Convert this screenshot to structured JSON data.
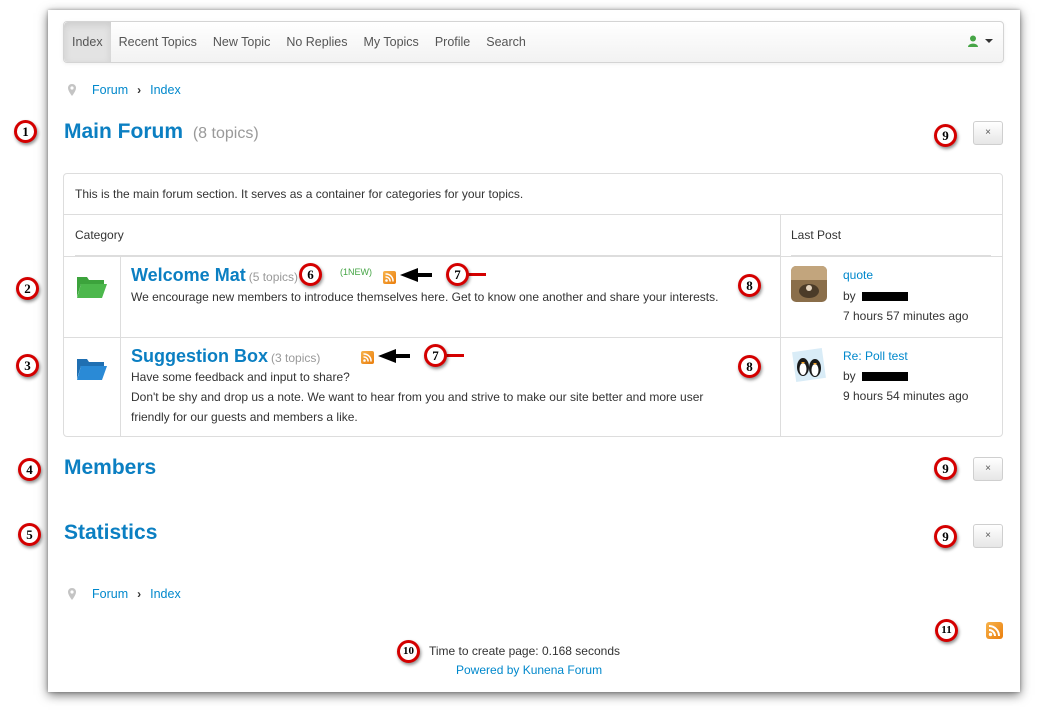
{
  "navbar": {
    "items": [
      "Index",
      "Recent Topics",
      "New Topic",
      "No Replies",
      "My Topics",
      "Profile",
      "Search"
    ],
    "active_index": 0,
    "user_icon": "user-icon",
    "colors": {
      "user_icon": "#46a546"
    }
  },
  "breadcrumb": {
    "forum": "Forum",
    "index": "Index",
    "separator": "›"
  },
  "main_forum": {
    "title": "Main Forum",
    "count": "(8 topics)",
    "description": "This is the main forum section. It serves as a container for categories for your topics.",
    "columns": {
      "category": "Category",
      "last_post": "Last Post"
    },
    "close_label": "×"
  },
  "categories": [
    {
      "title": "Welcome Mat",
      "topics": "(5 topics)",
      "new_badge": "(1NEW)",
      "description": "We encourage new members to introduce themselves here. Get to know one another and share your interests.",
      "folder_icon": "folder-open-icon",
      "folder_color": "#3ca33c",
      "last_post": {
        "title": "quote",
        "by": "by",
        "time": "7 hours 57 minutes ago"
      }
    },
    {
      "title": "Suggestion Box",
      "topics": "(3 topics)",
      "description_line1": "Have some feedback and input to share?",
      "description_line2": "Don't be shy and drop us a note. We want to hear from you and strive to make our site better and more user",
      "description_line3": "friendly for our guests and members a like.",
      "folder_icon": "folder-open-icon",
      "folder_color": "#1f7fc8",
      "last_post": {
        "title": "Re: Poll test",
        "by": "by",
        "time": "9 hours 54 minutes ago"
      }
    }
  ],
  "members": {
    "title": "Members",
    "close_label": "×"
  },
  "statistics": {
    "title": "Statistics",
    "close_label": "×"
  },
  "footer": {
    "time": "Time to create page: 0.168 seconds",
    "powered": "Powered by Kunena Forum",
    "rss_icon": "rss-icon"
  },
  "markers": [
    "1",
    "2",
    "3",
    "4",
    "5",
    "6",
    "7",
    "7",
    "8",
    "8",
    "9",
    "9",
    "9",
    "10",
    "11"
  ]
}
